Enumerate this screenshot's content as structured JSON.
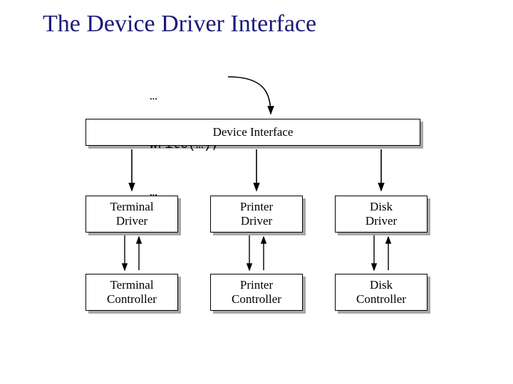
{
  "title": "The Device Driver Interface",
  "code": {
    "line1": "…",
    "line2": "write(…);",
    "line3": "…"
  },
  "boxes": {
    "interface": "Device Interface",
    "drivers": {
      "terminal": {
        "l1": "Terminal",
        "l2": "Driver"
      },
      "printer": {
        "l1": "Printer",
        "l2": "Driver"
      },
      "disk": {
        "l1": "Disk",
        "l2": "Driver"
      }
    },
    "controllers": {
      "terminal": {
        "l1": "Terminal",
        "l2": "Controller"
      },
      "printer": {
        "l1": "Printer",
        "l2": "Controller"
      },
      "disk": {
        "l1": "Disk",
        "l2": "Controller"
      }
    }
  },
  "chart_data": {
    "type": "hierarchy-diagram",
    "title": "The Device Driver Interface",
    "call": "write(…);",
    "interface": "Device Interface",
    "paths": [
      {
        "driver": "Terminal Driver",
        "controller": "Terminal Controller"
      },
      {
        "driver": "Printer Driver",
        "controller": "Printer Controller"
      },
      {
        "driver": "Disk Driver",
        "controller": "Disk Controller"
      }
    ],
    "annotations": [
      "write(…) call flows into Device Interface",
      "Device Interface dispatches down to each Driver",
      "Each Driver has a bidirectional link to its Controller"
    ]
  }
}
